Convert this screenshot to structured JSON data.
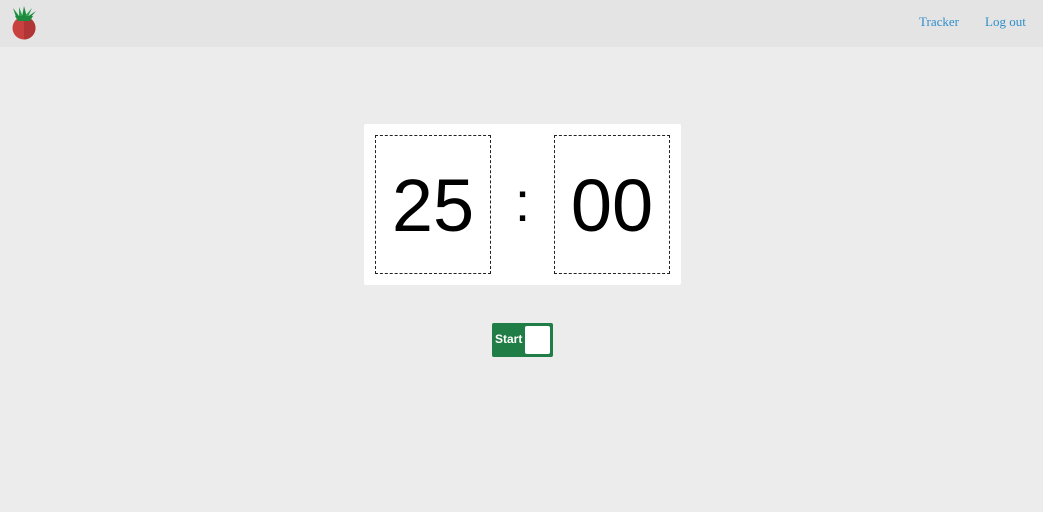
{
  "navbar": {
    "logo_icon": "tomato-logo-icon",
    "links": [
      {
        "label": "Tracker"
      },
      {
        "label": "Log out"
      }
    ],
    "link_color": "#2e8fcb"
  },
  "timer": {
    "minutes": "25",
    "separator": ":",
    "seconds": "00"
  },
  "control": {
    "start_label": "Start",
    "toggle_on": false,
    "accent_color": "#1f7d45"
  }
}
